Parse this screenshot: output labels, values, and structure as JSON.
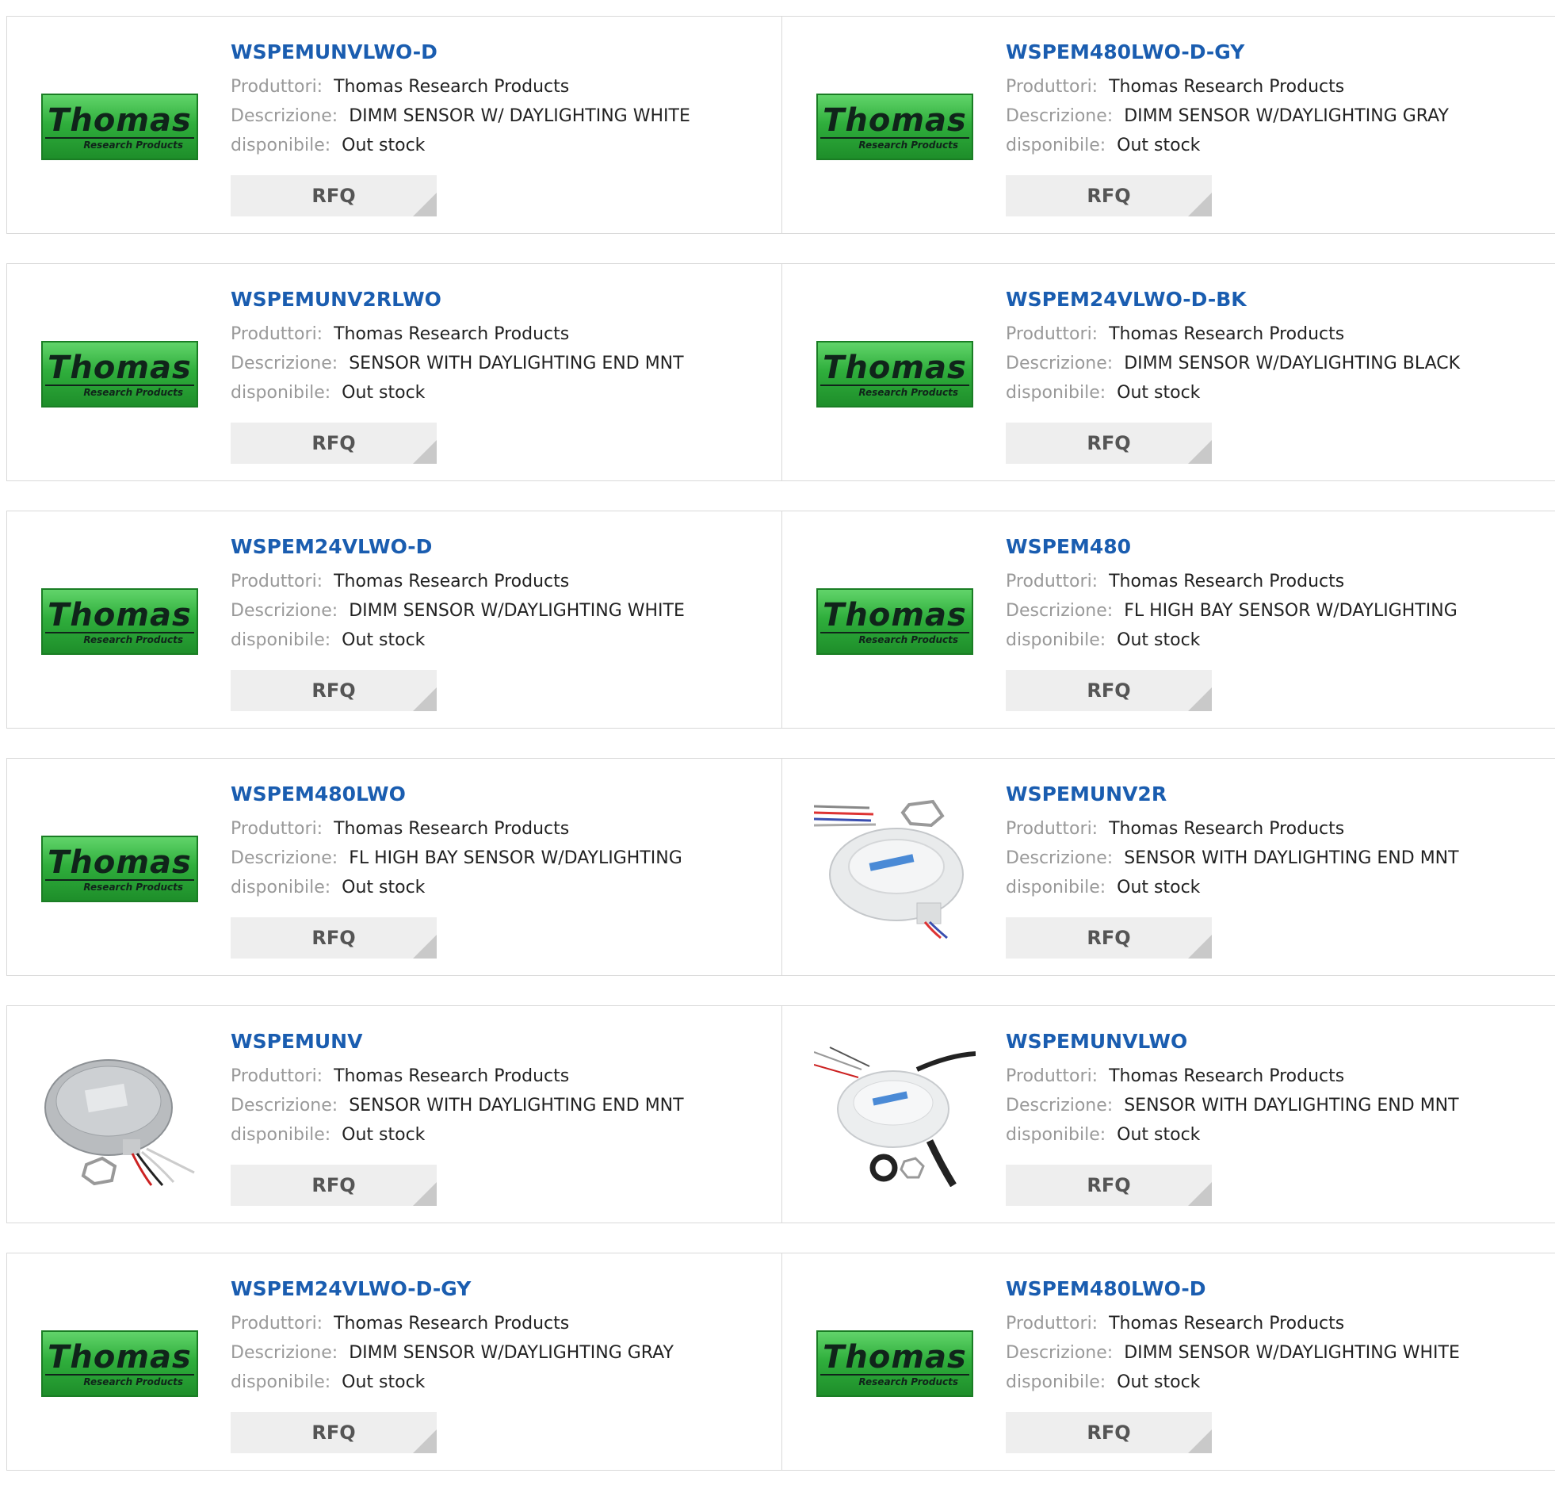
{
  "labels": {
    "manufacturer": "Produttori:",
    "description": "Descrizione:",
    "availability": "disponibile:"
  },
  "logo": {
    "main": "Thomas",
    "sub": "Research Products"
  },
  "colors": {
    "link": "#1a5db0",
    "label": "#999999",
    "logo_green": "#2fae3c",
    "button_bg": "#eeeeee"
  },
  "products": [
    {
      "part": "WSPEMUNVLWO-D",
      "manufacturer": "Thomas Research Products",
      "description": "DIMM SENSOR W/ DAYLIGHTING WHITE",
      "availability": "Out stock",
      "button": "RFQ",
      "image": "thomas-logo"
    },
    {
      "part": "WSPEM480LWO-D-GY",
      "manufacturer": "Thomas Research Products",
      "description": "DIMM SENSOR W/DAYLIGHTING GRAY",
      "availability": "Out stock",
      "button": "RFQ",
      "image": "thomas-logo"
    },
    {
      "part": "WSPEMUNV2RLWO",
      "manufacturer": "Thomas Research Products",
      "description": "SENSOR WITH DAYLIGHTING END MNT",
      "availability": "Out stock",
      "button": "RFQ",
      "image": "thomas-logo"
    },
    {
      "part": "WSPEM24VLWO-D-BK",
      "manufacturer": "Thomas Research Products",
      "description": "DIMM SENSOR W/DAYLIGHTING BLACK",
      "availability": "Out stock",
      "button": "RFQ",
      "image": "thomas-logo"
    },
    {
      "part": "WSPEM24VLWO-D",
      "manufacturer": "Thomas Research Products",
      "description": "DIMM SENSOR W/DAYLIGHTING WHITE",
      "availability": "Out stock",
      "button": "RFQ",
      "image": "thomas-logo"
    },
    {
      "part": "WSPEM480",
      "manufacturer": "Thomas Research Products",
      "description": "FL HIGH BAY SENSOR W/DAYLIGHTING",
      "availability": "Out stock",
      "button": "RFQ",
      "image": "thomas-logo"
    },
    {
      "part": "WSPEM480LWO",
      "manufacturer": "Thomas Research Products",
      "description": "FL HIGH BAY SENSOR W/DAYLIGHTING",
      "availability": "Out stock",
      "button": "RFQ",
      "image": "thomas-logo"
    },
    {
      "part": "WSPEMUNV2R",
      "manufacturer": "Thomas Research Products",
      "description": "SENSOR WITH DAYLIGHTING END MNT",
      "availability": "Out stock",
      "button": "RFQ",
      "image": "sensor-photo-color-wires"
    },
    {
      "part": "WSPEMUNV",
      "manufacturer": "Thomas Research Products",
      "description": "SENSOR WITH DAYLIGHTING END MNT",
      "availability": "Out stock",
      "button": "RFQ",
      "image": "sensor-photo-clear"
    },
    {
      "part": "WSPEMUNVLWO",
      "manufacturer": "Thomas Research Products",
      "description": "SENSOR WITH DAYLIGHTING END MNT",
      "availability": "Out stock",
      "button": "RFQ",
      "image": "sensor-photo-black-cable"
    },
    {
      "part": "WSPEM24VLWO-D-GY",
      "manufacturer": "Thomas Research Products",
      "description": "DIMM SENSOR W/DAYLIGHTING GRAY",
      "availability": "Out stock",
      "button": "RFQ",
      "image": "thomas-logo"
    },
    {
      "part": "WSPEM480LWO-D",
      "manufacturer": "Thomas Research Products",
      "description": "DIMM SENSOR W/DAYLIGHTING WHITE",
      "availability": "Out stock",
      "button": "RFQ",
      "image": "thomas-logo"
    }
  ]
}
